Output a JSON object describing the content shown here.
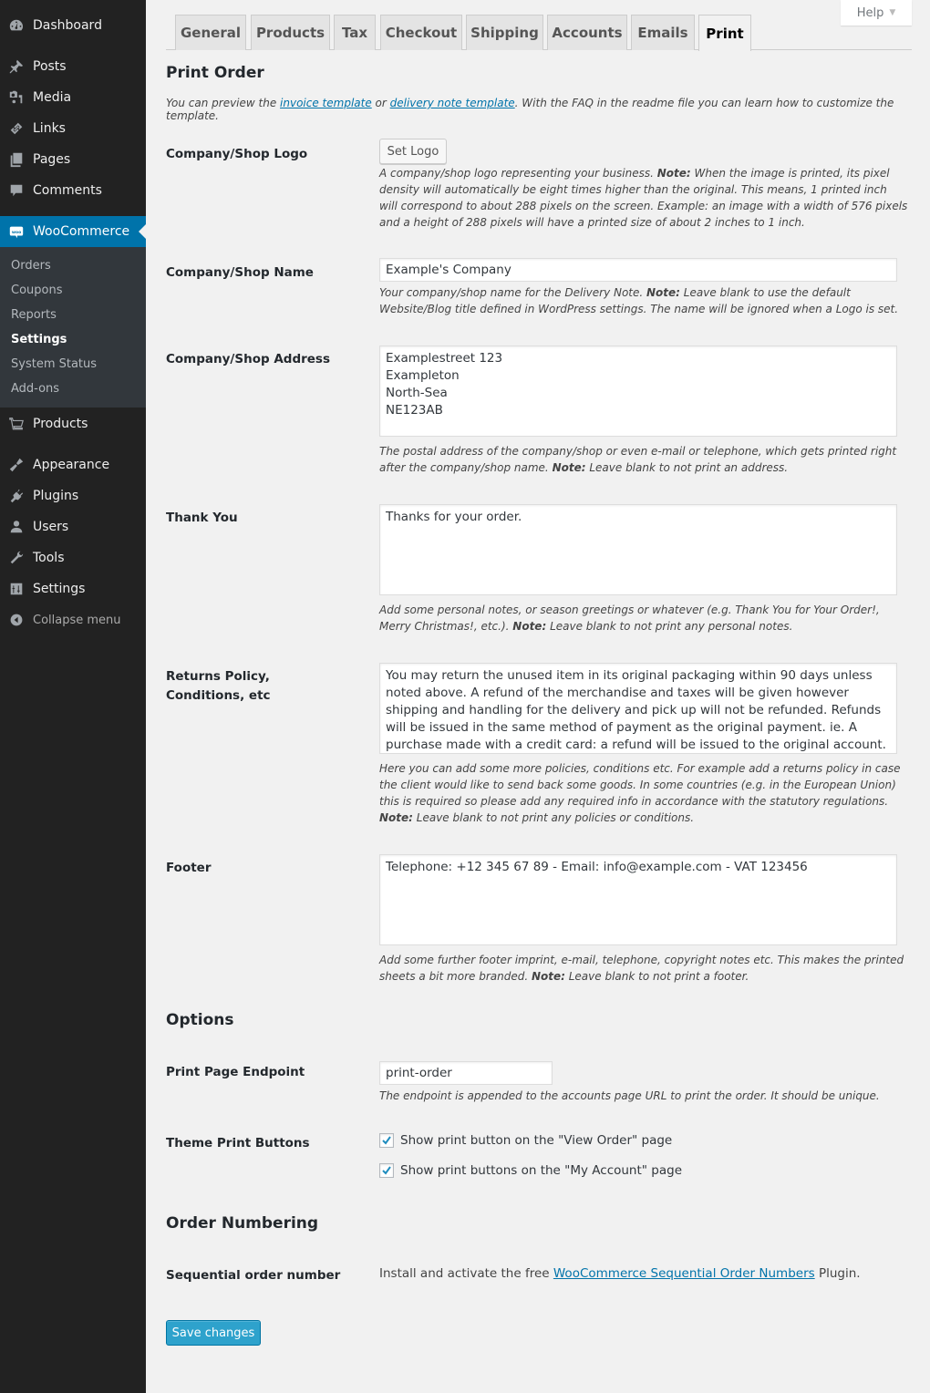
{
  "sidebar": {
    "items": [
      {
        "label": "Dashboard",
        "icon": "dashboard-icon"
      },
      {
        "label": "Posts",
        "icon": "pin-icon"
      },
      {
        "label": "Media",
        "icon": "media-icon"
      },
      {
        "label": "Links",
        "icon": "link-icon"
      },
      {
        "label": "Pages",
        "icon": "pages-icon"
      },
      {
        "label": "Comments",
        "icon": "comment-icon"
      },
      {
        "label": "WooCommerce",
        "icon": "woo-icon"
      },
      {
        "label": "Products",
        "icon": "cart-icon"
      },
      {
        "label": "Appearance",
        "icon": "brush-icon"
      },
      {
        "label": "Plugins",
        "icon": "plugin-icon"
      },
      {
        "label": "Users",
        "icon": "user-icon"
      },
      {
        "label": "Tools",
        "icon": "wrench-icon"
      },
      {
        "label": "Settings",
        "icon": "sliders-icon"
      }
    ],
    "submenu": [
      "Orders",
      "Coupons",
      "Reports",
      "Settings",
      "System Status",
      "Add-ons"
    ],
    "submenu_current": "Settings",
    "collapse_label": "Collapse menu",
    "accent_color": "#0073aa"
  },
  "help_label": "Help",
  "tabs": [
    "General",
    "Products",
    "Tax",
    "Checkout",
    "Shipping",
    "Accounts",
    "Emails",
    "Print"
  ],
  "active_tab": "Print",
  "print_order": {
    "heading": "Print Order",
    "intro": {
      "pre": "You can preview the ",
      "link1": "invoice template",
      "mid": " or ",
      "link2": "delivery note template",
      "post": ". With the FAQ in the readme file you can learn how to customize the template."
    },
    "logo": {
      "label": "Company/Shop Logo",
      "button": "Set Logo",
      "desc_pre": "A company/shop logo representing your business. ",
      "desc_note": "Note:",
      "desc_post": " When the image is printed, its pixel density will automatically be eight times higher than the original. This means, 1 printed inch will correspond to about 288 pixels on the screen. Example: an image with a width of 576 pixels and a height of 288 pixels will have a printed size of about 2 inches to 1 inch."
    },
    "name": {
      "label": "Company/Shop Name",
      "value": "Example's Company",
      "desc_pre": "Your company/shop name for the Delivery Note. ",
      "desc_note": "Note:",
      "desc_post": " Leave blank to use the default Website/Blog title defined in WordPress settings. The name will be ignored when a Logo is set."
    },
    "address": {
      "label": "Company/Shop Address",
      "value": "Examplestreet 123\nExampleton\nNorth-Sea\nNE123AB",
      "desc_pre": "The postal address of the company/shop or even e-mail or telephone, which gets printed right after the company/shop name. ",
      "desc_note": "Note:",
      "desc_post": " Leave blank to not print an address."
    },
    "thank_you": {
      "label": "Thank You",
      "value": "Thanks for your order.",
      "desc_pre": "Add some personal notes, or season greetings or whatever (e.g. Thank You for Your Order!, Merry Christmas!, etc.). ",
      "desc_note": "Note:",
      "desc_post": " Leave blank to not print any personal notes."
    },
    "returns": {
      "label": "Returns Policy, Conditions, etc",
      "value": "You may return the unused item in its original packaging within 90 days unless noted above. A refund of the merchandise and taxes will be given however shipping and handling for the delivery and pick up will not be refunded. Refunds will be issued in the same method of payment as the original payment. ie. A purchase made with a credit card: a refund will be issued to the original account.",
      "desc_pre": "Here you can add some more policies, conditions etc. For example add a returns policy in case the client would like to send back some goods. In some countries (e.g. in the European Union) this is required so please add any required info in accordance with the statutory regulations. ",
      "desc_note": "Note:",
      "desc_post": " Leave blank to not print any policies or conditions."
    },
    "footer": {
      "label": "Footer",
      "value": "Telephone: +12 345 67 89 - Email: info@example.com - VAT 123456",
      "desc_pre": "Add some further footer imprint, e-mail, telephone, copyright notes etc. This makes the printed sheets a bit more branded. ",
      "desc_note": "Note:",
      "desc_post": " Leave blank to not print a footer."
    }
  },
  "options": {
    "heading": "Options",
    "endpoint": {
      "label": "Print Page Endpoint",
      "value": "print-order",
      "desc": "The endpoint is appended to the accounts page URL to print the order. It should be unique."
    },
    "theme_buttons": {
      "label": "Theme Print Buttons",
      "checkboxes": [
        {
          "label": "Show print button on the \"View Order\" page",
          "checked": true
        },
        {
          "label": "Show print buttons on the \"My Account\" page",
          "checked": true
        }
      ]
    }
  },
  "order_numbering": {
    "heading": "Order Numbering",
    "label": "Sequential order number",
    "text_pre": "Install and activate the free ",
    "link": "WooCommerce Sequential Order Numbers",
    "text_post": " Plugin."
  },
  "save_label": "Save changes"
}
